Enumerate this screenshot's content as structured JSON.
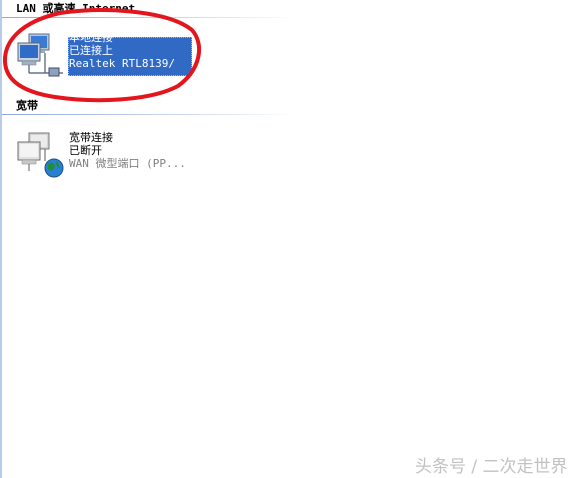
{
  "groups": [
    {
      "header": "LAN 或高速 Internet"
    },
    {
      "header": "宽带"
    }
  ],
  "connections": [
    {
      "name": "本地连接",
      "status": "已连接上",
      "device": "Realtek RTL8139/",
      "icon": "network-computers-icon",
      "selected": true
    },
    {
      "name": "宽带连接",
      "status": "已断开",
      "device": "WAN 微型端口 (PP...",
      "icon": "broadband-globe-icon",
      "selected": false
    }
  ],
  "annotation": {
    "color": "#e3151d"
  },
  "watermark": {
    "text": "头条号 / 二次走世界"
  },
  "colors": {
    "selection": "#316ac5",
    "accent_globe": "#1e8f3a"
  }
}
